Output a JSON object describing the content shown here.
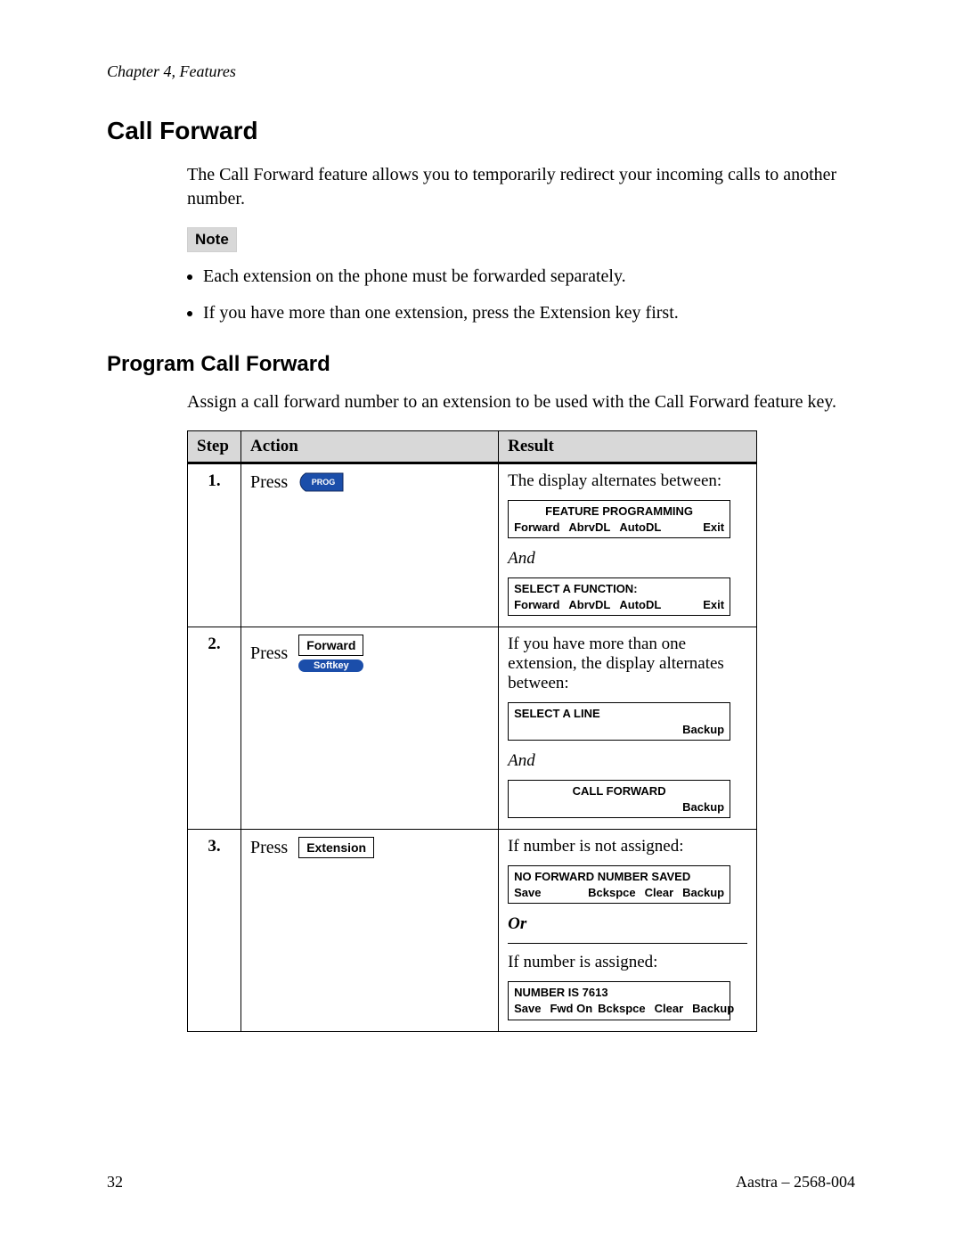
{
  "header": {
    "chapter": "Chapter 4, Features"
  },
  "section": {
    "title": "Call Forward"
  },
  "intro": "The Call Forward feature allows you to temporarily redirect your incoming calls to another number.",
  "note": {
    "label": "Note",
    "items": [
      "Each extension on the phone must be forwarded separately.",
      "If you have more than one extension, press the Extension key first."
    ]
  },
  "subsection": {
    "title": "Program Call Forward",
    "intro": "Assign a call forward number to an extension to be used with the Call Forward feature key."
  },
  "table": {
    "headers": {
      "step": "Step",
      "action": "Action",
      "result": "Result"
    },
    "rows": [
      {
        "step": "1.",
        "action": {
          "label": "Press",
          "key": {
            "type": "prog",
            "text": "PROG"
          }
        },
        "result": {
          "text1": "The display alternates between:",
          "lcd1": {
            "line1_center": "FEATURE PROGRAMMING",
            "left": [
              "Forward",
              "AbrvDL",
              "AutoDL"
            ],
            "right": [
              "Exit"
            ]
          },
          "and": "And",
          "lcd2": {
            "line1_left": "SELECT A FUNCTION:",
            "left": [
              "Forward",
              "AbrvDL",
              "AutoDL"
            ],
            "right": [
              "Exit"
            ]
          }
        }
      },
      {
        "step": "2.",
        "action": {
          "label": "Press",
          "key": {
            "type": "softkey",
            "outline": "Forward",
            "chip": "Softkey"
          }
        },
        "result": {
          "text1": "If you have more than one extension, the display alternates between:",
          "lcd1": {
            "line1_left": "SELECT A LINE",
            "right": [
              "Backup"
            ]
          },
          "and": "And",
          "lcd2": {
            "line1_center": "CALL FORWARD",
            "right": [
              "Backup"
            ]
          }
        }
      },
      {
        "step": "3.",
        "action": {
          "label": "Press",
          "key": {
            "type": "outline",
            "outline": "Extension"
          }
        },
        "result": {
          "text1": "If number is not assigned:",
          "lcd1": {
            "line1_left": "NO FORWARD NUMBER SAVED",
            "left": [
              "Save"
            ],
            "right": [
              "Bckspce",
              "Clear",
              "Backup"
            ]
          },
          "or": "Or",
          "text2": "If number is assigned:",
          "lcd2": {
            "line1_left": "NUMBER IS 7613",
            "left": [
              "Save",
              "Fwd On"
            ],
            "right": [
              "Bckspce",
              "Clear",
              "Backup"
            ]
          }
        }
      }
    ]
  },
  "footer": {
    "page": "32",
    "doc": "Aastra – 2568-004"
  }
}
